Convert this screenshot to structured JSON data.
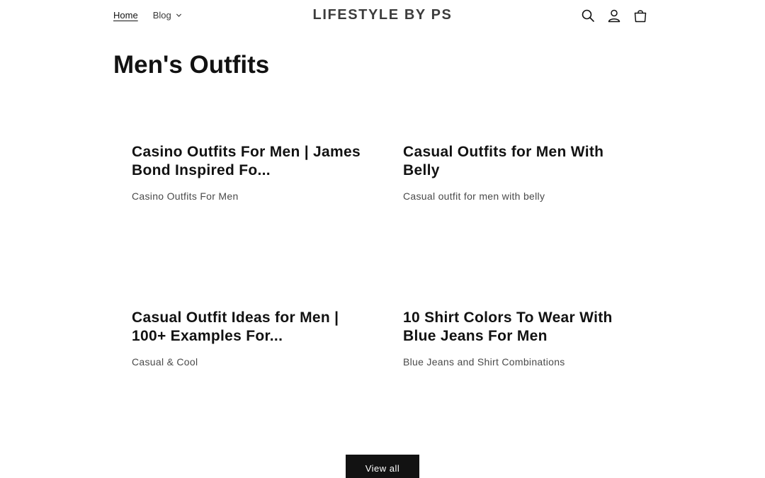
{
  "header": {
    "nav": {
      "home_label": "Home",
      "blog_label": "Blog"
    },
    "logo_text": "LIFESTYLE BY PS",
    "icons": [
      "search-icon",
      "account-icon",
      "cart-icon"
    ]
  },
  "main": {
    "title": "Men's Outfits",
    "articles": [
      {
        "title": "Casino Outfits For Men | James Bond Inspired Fo...",
        "excerpt": "Casino Outfits For Men"
      },
      {
        "title": "Casual Outfits for Men With Belly",
        "excerpt": "Casual outfit for men with belly"
      },
      {
        "title": "Casual Outfit Ideas for Men | 100+ Examples For...",
        "excerpt": "Casual & Cool"
      },
      {
        "title": "10 Shirt Colors To Wear With Blue Jeans For Men",
        "excerpt": "Blue Jeans and Shirt Combinations"
      }
    ],
    "view_all_label": "View all"
  },
  "colors": {
    "text": "#121212",
    "button_bg": "#121212",
    "button_text": "#ffffff"
  }
}
